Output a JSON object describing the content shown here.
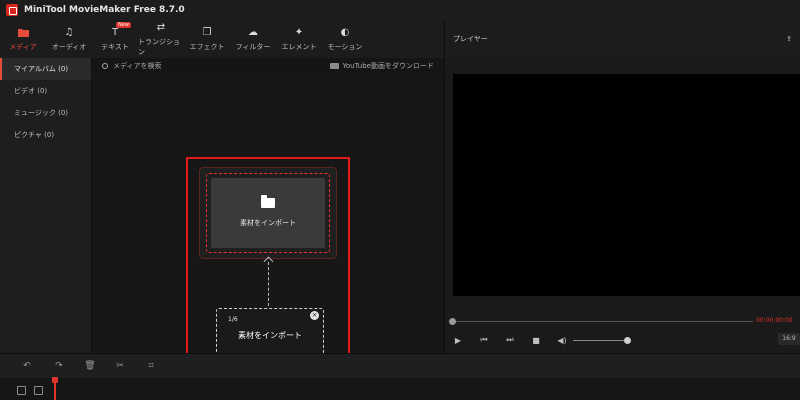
{
  "app": {
    "title": "MiniTool MovieMaker Free 8.7.0"
  },
  "toolbar": {
    "items": [
      {
        "label": "メディア",
        "icon": "folder-icon",
        "active": true
      },
      {
        "label": "オーディオ",
        "icon": "music-icon"
      },
      {
        "label": "テキスト",
        "icon": "text-icon",
        "badge": "New"
      },
      {
        "label": "トランジション",
        "icon": "transition-icon"
      },
      {
        "label": "エフェクト",
        "icon": "effect-icon"
      },
      {
        "label": "フィルター",
        "icon": "filter-icon"
      },
      {
        "label": "エレメント",
        "icon": "element-icon"
      },
      {
        "label": "モーション",
        "icon": "motion-icon"
      }
    ]
  },
  "player": {
    "title": "プレイヤー",
    "timecode": "00:00:00:00",
    "ratio": "16:9"
  },
  "sidebar": {
    "items": [
      {
        "label": "マイアルバム (0)",
        "active": true
      },
      {
        "label": "ビデオ (0)"
      },
      {
        "label": "ミュージック (0)"
      },
      {
        "label": "ピクチャ (0)"
      }
    ]
  },
  "media": {
    "search_label": "メディアを検索",
    "youtube_label": "YouTube動画をダウンロード",
    "import_label": "素材をインポート"
  },
  "tooltip": {
    "step": "1/6",
    "text": "素材をインポート"
  },
  "colors": {
    "accent": "#e0332b",
    "highlight": "#e21b1b",
    "bg": "#151515"
  }
}
